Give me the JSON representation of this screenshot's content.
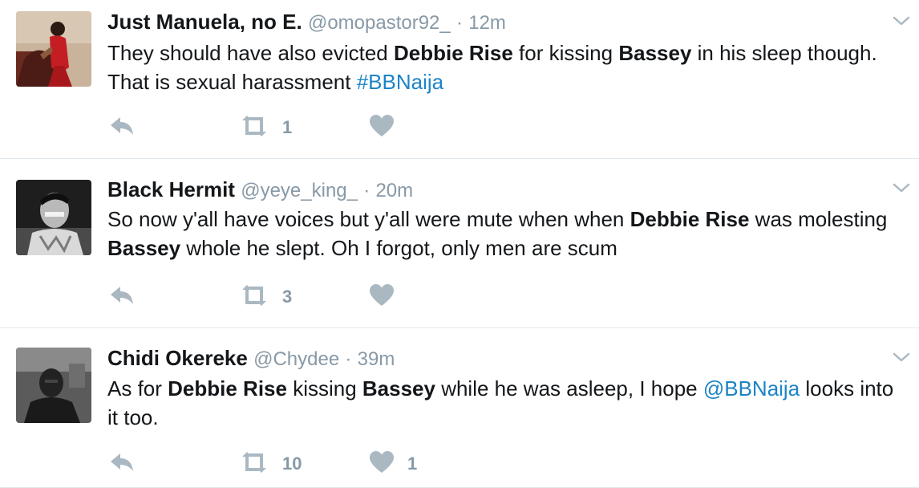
{
  "colors": {
    "name": "#14171a",
    "meta": "#8899a6",
    "link": "#1b95e0",
    "icon": "#aab8c2",
    "divider": "#e1e8ed"
  },
  "tweets": [
    {
      "name": "Just Manuela, no E.",
      "handle": "@omopastor92_",
      "dot": "·",
      "time": "12m",
      "text": {
        "p1": "They should have also evicted ",
        "b1": "Debbie Rise",
        "p2": " for kissing ",
        "b2": "Bassey",
        "p3": " in his sleep though. That is sexual harassment ",
        "link": "#BBNaija"
      },
      "retweets": "1",
      "likes": ""
    },
    {
      "name": "Black Hermit",
      "handle": "@yeye_king_",
      "dot": "·",
      "time": "20m",
      "text": {
        "p1": "So now y'all have voices but y'all were mute when when ",
        "b1": "Debbie Rise",
        "p2": " was molesting ",
        "b2": "Bassey",
        "p3": " whole he slept. Oh I forgot, only men are scum"
      },
      "retweets": "3",
      "likes": ""
    },
    {
      "name": "Chidi Okereke",
      "handle": "@Chydee",
      "dot": "·",
      "time": "39m",
      "text": {
        "p1": "As for ",
        "b1": "Debbie Rise",
        "p2": " kissing ",
        "b2": "Bassey",
        "p3": " while he was asleep, I hope ",
        "link": "@BBNaija",
        "p4": " looks into it too."
      },
      "retweets": "10",
      "likes": "1"
    }
  ]
}
